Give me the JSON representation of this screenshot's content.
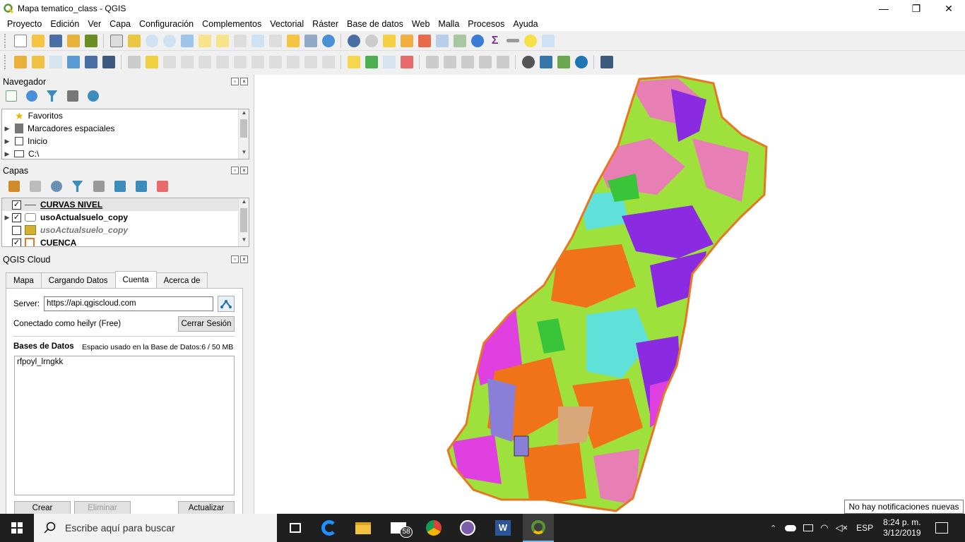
{
  "window": {
    "title": "Mapa tematico_class - QGIS",
    "minimize": "—",
    "maximize": "❐",
    "close": "✕"
  },
  "menu": [
    "Proyecto",
    "Edición",
    "Ver",
    "Capa",
    "Configuración",
    "Complementos",
    "Vectorial",
    "Ráster",
    "Base de datos",
    "Web",
    "Malla",
    "Procesos",
    "Ayuda"
  ],
  "navigator": {
    "title": "Navegador",
    "items": [
      "Favoritos",
      "Marcadores espaciales",
      "Inicio",
      "C:\\"
    ]
  },
  "layers": {
    "title": "Capas",
    "items": [
      {
        "name": "CURVAS NIVEL",
        "checked": true
      },
      {
        "name": "usoActualsuelo_copy",
        "checked": true
      },
      {
        "name": "usoActualsuelo_copy",
        "checked": false
      },
      {
        "name": "CUENCA",
        "checked": true
      }
    ]
  },
  "cloud": {
    "title": "QGIS Cloud",
    "tabs": [
      "Mapa",
      "Cargando Datos",
      "Cuenta",
      "Acerca de"
    ],
    "active_tab": "Cuenta",
    "server_label": "Server:",
    "server_value": "https://api.qgiscloud.com",
    "connected_text": "Conectado como heilyr (Free)",
    "logout_button": "Cerrar Sesión",
    "db_heading": "Bases de Datos",
    "db_space": "Espacio usado en la Base de Datos:6 / 50 MB",
    "databases": [
      "rfpoyl_lrngkk"
    ],
    "create_button": "Crear",
    "delete_button": "Eliminar",
    "refresh_button": "Actualizar"
  },
  "taskbar": {
    "search_placeholder": "Escribe aquí para buscar",
    "mail_badge": "58",
    "lang": "ESP",
    "time": "8:24 p. m.",
    "date": "3/12/2019"
  },
  "notification": "No hay notificaciones nuevas",
  "colors": {
    "qgis_green": "#589632",
    "basin_outline": "#e87722",
    "map_green": "#9ee03c",
    "map_pink": "#e87fb4",
    "map_orange": "#f0731a",
    "map_purple": "#8a2be2",
    "map_cyan": "#5fe0d8",
    "map_magenta": "#e040e0"
  }
}
